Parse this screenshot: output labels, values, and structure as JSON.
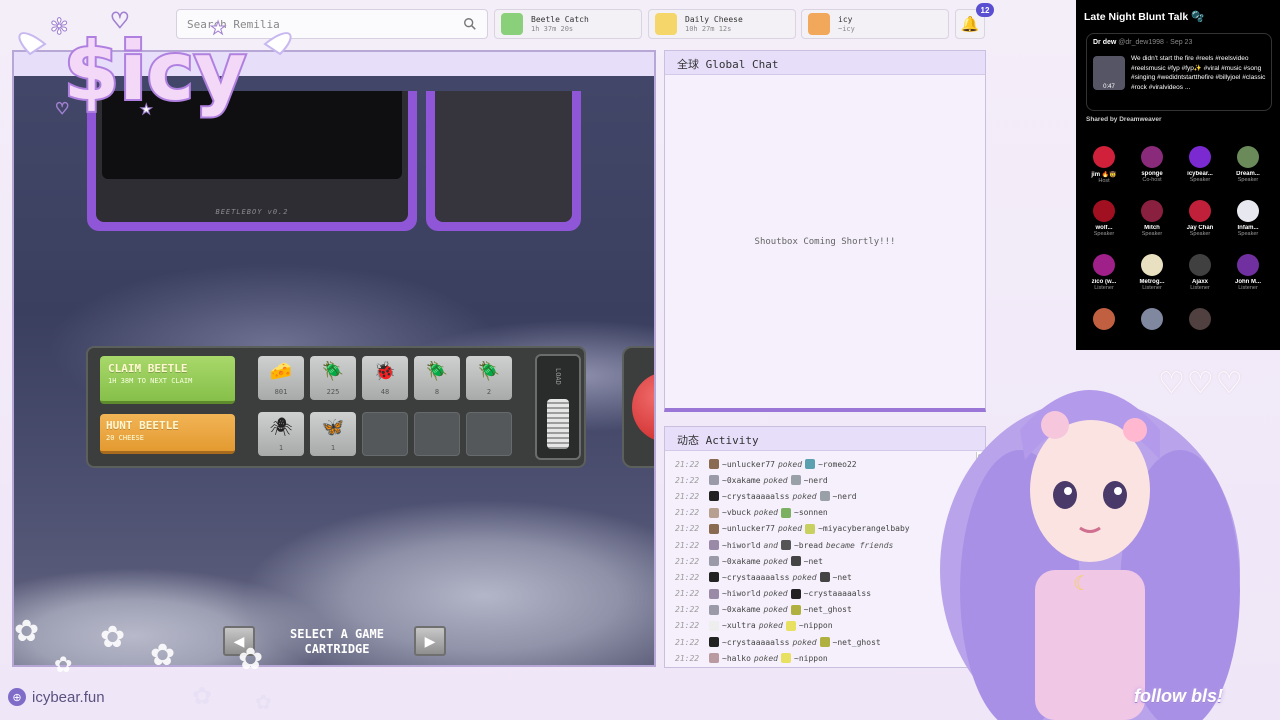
{
  "logo": {
    "text": "$icy"
  },
  "search": {
    "placeholder": "Search Remilia"
  },
  "top_pills": [
    {
      "title": "Beetle Catch",
      "sub": "1h 37m 20s",
      "icon": "beetle-icon",
      "color": "#8ad07a"
    },
    {
      "title": "Daily Cheese",
      "sub": "10h 27m 12s",
      "icon": "cheese-icon",
      "color": "#f5d66a"
    },
    {
      "title": "icy",
      "sub": "~icy",
      "icon": "cat-icon",
      "color": "#f2a85a"
    }
  ],
  "notifications": {
    "count": "12"
  },
  "game": {
    "screen_brand": "BEETLEBOY v0.2",
    "claim": {
      "label": "CLAIM BEETLE",
      "sub": "1H 38M TO NEXT CLAIM"
    },
    "hunt": {
      "label": "HUNT BEETLE",
      "sub": "20 CHEESE"
    },
    "inventory": [
      {
        "glyph": "🧀",
        "count": "801",
        "name": "cheese"
      },
      {
        "glyph": "🪲",
        "count": "225",
        "name": "green-beetle"
      },
      {
        "glyph": "🐞",
        "count": "48",
        "name": "ladybug"
      },
      {
        "glyph": "🪲",
        "count": "8",
        "name": "purple-beetle"
      },
      {
        "glyph": "🪲",
        "count": "2",
        "name": "blue-beetle"
      },
      {
        "glyph": "🕷",
        "count": "1",
        "name": "black-beetle"
      },
      {
        "glyph": "🦋",
        "count": "1",
        "name": "butterfly"
      }
    ],
    "loader_label": "LOAD",
    "select_line1": "SELECT A GAME",
    "select_line2": "CARTRIDGE"
  },
  "chat": {
    "title": "全球 Global Chat",
    "message": "Shoutbox Coming Shortly!!!"
  },
  "activity": {
    "title": "动态 Activity",
    "rows": [
      {
        "time": "21:22",
        "from": "~unlucker77",
        "verb": "poked",
        "to": "~romeo22",
        "c1": "#8a6a50",
        "c2": "#5aa0b0"
      },
      {
        "time": "21:22",
        "from": "~0xakame",
        "verb": "poked",
        "to": "~nerd",
        "c1": "#9a9aa8",
        "c2": "#9aa0a8"
      },
      {
        "time": "21:22",
        "from": "~crystaaaaalss",
        "verb": "poked",
        "to": "~nerd",
        "c1": "#222",
        "c2": "#9aa0a8"
      },
      {
        "time": "21:22",
        "from": "~vbuck",
        "verb": "poked",
        "to": "~sonnen",
        "c1": "#b8a090",
        "c2": "#7ab060"
      },
      {
        "time": "21:22",
        "from": "~unlucker77",
        "verb": "poked",
        "to": "~miyacyberangelbaby",
        "c1": "#8a6a50",
        "c2": "#c8d060"
      },
      {
        "time": "21:22",
        "from": "~hiworld",
        "verb": "and",
        "to": "~bread",
        "extra": "became friends",
        "c1": "#9a8aa8",
        "c2": "#555"
      },
      {
        "time": "21:22",
        "from": "~0xakame",
        "verb": "poked",
        "to": "~net",
        "c1": "#9a9aa8",
        "c2": "#444"
      },
      {
        "time": "21:22",
        "from": "~crystaaaaalss",
        "verb": "poked",
        "to": "~net",
        "c1": "#222",
        "c2": "#444"
      },
      {
        "time": "21:22",
        "from": "~hiworld",
        "verb": "poked",
        "to": "~crystaaaaalss",
        "c1": "#9a8aa8",
        "c2": "#222"
      },
      {
        "time": "21:22",
        "from": "~0xakame",
        "verb": "poked",
        "to": "~net_ghost",
        "c1": "#9a9aa8",
        "c2": "#b0b040"
      },
      {
        "time": "21:22",
        "from": "~xultra",
        "verb": "poked",
        "to": "~nippon",
        "c1": "#eee",
        "c2": "#e8e060"
      },
      {
        "time": "21:22",
        "from": "~crystaaaaalss",
        "verb": "poked",
        "to": "~net_ghost",
        "c1": "#222",
        "c2": "#b0b040"
      },
      {
        "time": "21:22",
        "from": "~halko",
        "verb": "poked",
        "to": "~nippon",
        "c1": "#b89aa0",
        "c2": "#e8e060"
      }
    ]
  },
  "twitter": {
    "title": "Late Night Blunt Talk 🫧",
    "author": "Dr dew",
    "handle": "@dr_dew1998 · Sep 23",
    "duration": "0:47",
    "text": "We didn't start the fire #reels #reelsvideo #reelsmusic #fyp #fyp✨ #viral #music #song #singing #wedidntstartthefire #billyjoel #classic #rock #viralvideos ...",
    "shared": "Shared by Dreamweaver",
    "speakers": [
      {
        "name": "jim 🔥🤠",
        "role": "Host",
        "color": "#d0203a"
      },
      {
        "name": "sponge",
        "role": "Co-host",
        "color": "#8a2a7a"
      },
      {
        "name": "icybear...",
        "role": "Speaker",
        "color": "#7a2ad0"
      },
      {
        "name": "Dream...",
        "role": "Speaker",
        "color": "#6a8a5a"
      },
      {
        "name": "wolf...",
        "role": "Speaker",
        "color": "#a01020"
      },
      {
        "name": "Mitch",
        "role": "Speaker",
        "color": "#8a2040"
      },
      {
        "name": "Jay Chan",
        "role": "Speaker",
        "color": "#c0203a"
      },
      {
        "name": "Infam...",
        "role": "Speaker",
        "color": "#e8e8f0"
      },
      {
        "name": "zico (w...",
        "role": "Listener",
        "color": "#a0208a"
      },
      {
        "name": "Metrog...",
        "role": "Listener",
        "color": "#e8e0c0"
      },
      {
        "name": "Ajaxx",
        "role": "Listener",
        "color": "#404040"
      },
      {
        "name": "John M...",
        "role": "Listener",
        "color": "#7030a0"
      },
      {
        "name": "",
        "role": "",
        "color": "#c06040"
      },
      {
        "name": "",
        "role": "",
        "color": "#8088a0"
      },
      {
        "name": "",
        "role": "",
        "color": "#504040"
      }
    ]
  },
  "overlay": {
    "follow": "follow bls!",
    "hearts": "♡♡♡"
  },
  "footer": {
    "site": "icybear.fun"
  }
}
